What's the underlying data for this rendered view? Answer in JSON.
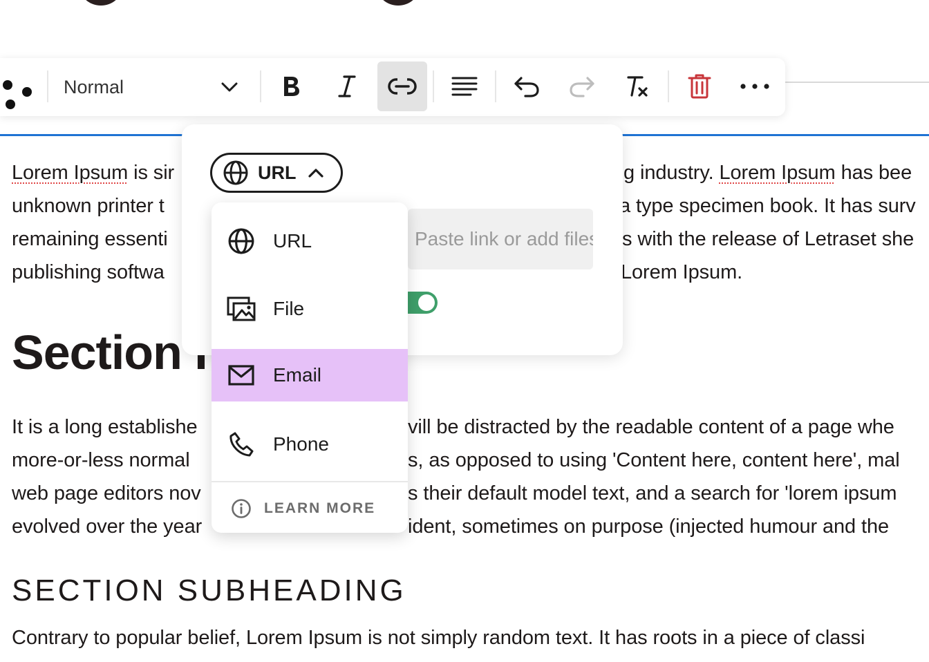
{
  "toolbar": {
    "block_style": "Normal",
    "buttons": [
      {
        "name": "bold",
        "icon": "bold-icon"
      },
      {
        "name": "italic",
        "icon": "italic-icon"
      },
      {
        "name": "link",
        "icon": "link-icon",
        "active": true
      },
      {
        "name": "align",
        "icon": "align-left-icon"
      },
      {
        "name": "undo",
        "icon": "undo-icon"
      },
      {
        "name": "redo",
        "icon": "redo-icon",
        "disabled": true
      },
      {
        "name": "clear-format",
        "icon": "clear-format-icon"
      },
      {
        "name": "delete",
        "icon": "trash-icon"
      },
      {
        "name": "more",
        "icon": "more-horizontal-icon"
      }
    ]
  },
  "link_popover": {
    "type_selector_label": "URL",
    "url_placeholder": "Paste link or add files",
    "url_visible_text": "r add files",
    "toggle_on": true,
    "menu": {
      "items": [
        {
          "label": "URL",
          "icon": "globe-icon",
          "selected": false
        },
        {
          "label": "File",
          "icon": "images-icon",
          "selected": false
        },
        {
          "label": "Email",
          "icon": "mail-icon",
          "selected": true
        },
        {
          "label": "Phone",
          "icon": "phone-icon",
          "selected": false
        }
      ],
      "learn_more": "LEARN MORE"
    }
  },
  "content": {
    "para1": {
      "line1_left_spell": "Lorem Ipsum",
      "line1_left_rest": " is sir",
      "line1_right_pre": "g industry. ",
      "line1_right_spell": "Lorem Ipsum",
      "line1_right_post": " has bee",
      "line2_left": "unknown printer t",
      "line2_right": "a type specimen book. It has surv",
      "line3_left": "remaining essenti",
      "line3_right": "s with the release of Letraset she",
      "line4_left": "publishing softwa",
      "line4_right": "Lorem Ipsum."
    },
    "heading": "Section H",
    "para2": {
      "line1_left": "It is a long establishe",
      "line1_right": "vill be distracted by the readable content of a page whe",
      "line2_left": "more-or-less normal",
      "line2_right": "s, as opposed to using 'Content here, content here', mal",
      "line3_left": "web page editors nov",
      "line3_right": "s their default model text, and a search for 'lorem ipsum",
      "line4_left": "evolved over the year",
      "line4_right": "ident, sometimes on purpose (injected humour and the"
    },
    "subheading": "SECTION SUBHEADING",
    "para3": "Contrary to popular belief, Lorem Ipsum is not simply random text. It has roots in a piece of classi"
  },
  "colors": {
    "accent_blue": "#1f73d3",
    "selected_item": "#e6c1f8",
    "toggle_green": "#3f9f6a",
    "delete_red": "#c8353a"
  }
}
